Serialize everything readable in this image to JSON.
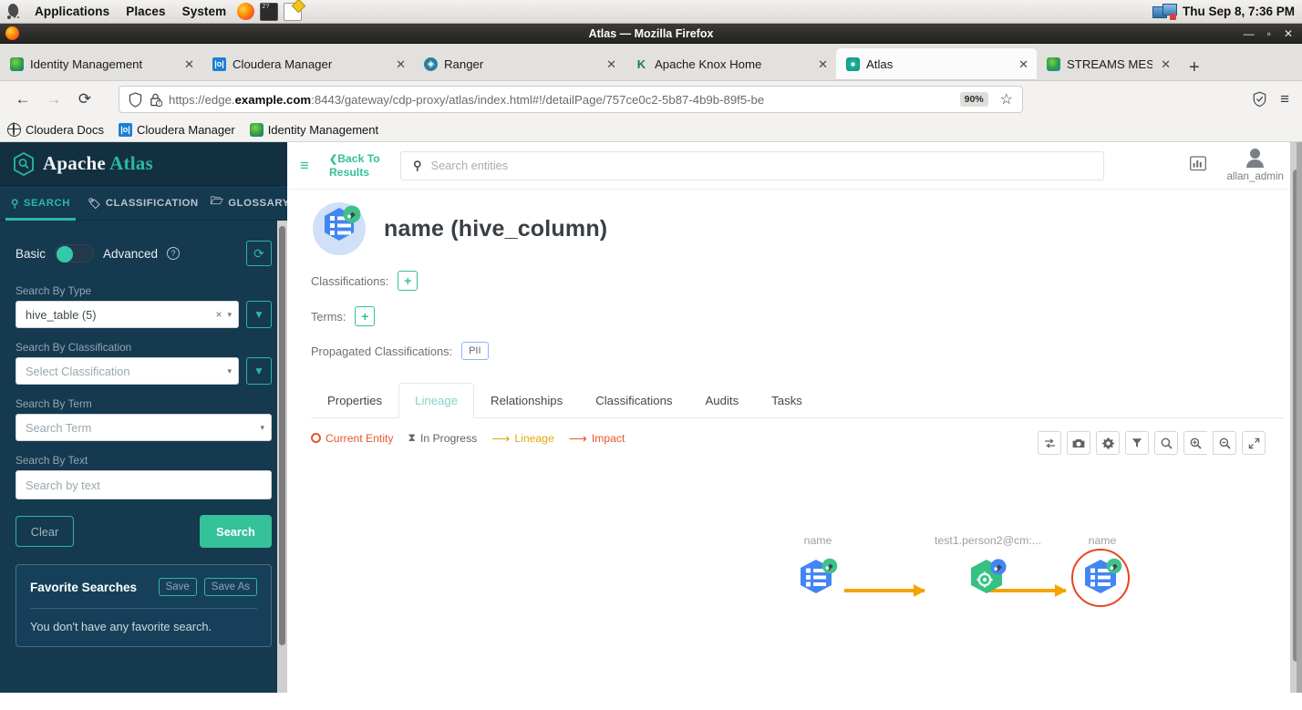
{
  "desktop": {
    "menus": [
      "Applications",
      "Places",
      "System"
    ],
    "launchers": [
      "firefox-icon",
      "terminal-icon",
      "text-editor-icon"
    ],
    "tray_icon": "displays-icon",
    "clock": "Thu Sep  8,  7:36 PM"
  },
  "window": {
    "title": "Atlas — Mozilla Firefox",
    "app_icon": "firefox-icon",
    "buttons": {
      "minimize": "—",
      "maximize": "▫",
      "close": "✕"
    }
  },
  "browser": {
    "tabs": [
      {
        "label": "Identity Management",
        "favicon": "identity-management-icon",
        "active": false
      },
      {
        "label": "Cloudera Manager",
        "favicon": "cloudera-manager-icon",
        "active": false
      },
      {
        "label": "Ranger",
        "favicon": "ranger-icon",
        "active": false
      },
      {
        "label": "Apache Knox Home",
        "favicon": "knox-icon",
        "active": false
      },
      {
        "label": "Atlas",
        "favicon": "atlas-icon",
        "active": true
      },
      {
        "label": "STREAMS MESSAGING M",
        "favicon": "smm-icon",
        "active": false
      }
    ],
    "new_tab_label": "+",
    "nav": {
      "back": "←",
      "forward": "→",
      "reload": "⟳"
    },
    "url": {
      "scheme": "https://edge.",
      "domain": "example.com",
      "path": ":8443/gateway/cdp-proxy/atlas/index.html#!/detailPage/757ce0c2-5b87-4b9b-89f5-be",
      "zoom_level": "90%",
      "shield_icon": "shield-icon",
      "lock_icon": "lock-warning-icon",
      "bookmark_icon": "star-icon"
    },
    "toolbar_right": [
      "tracking-protection-icon",
      "hamburger-menu-icon"
    ],
    "bookmarks": [
      {
        "label": "Cloudera Docs",
        "icon": "globe-icon"
      },
      {
        "label": "Cloudera Manager",
        "icon": "cloudera-manager-icon"
      },
      {
        "label": "Identity Management",
        "icon": "identity-management-icon"
      }
    ]
  },
  "atlas": {
    "brand": {
      "word1": "Apache",
      "word2": "Atlas",
      "icon": "atlas-hex-icon"
    },
    "side_tabs": [
      {
        "label": "SEARCH",
        "icon": "search-icon",
        "active": true
      },
      {
        "label": "CLASSIFICATION",
        "icon": "tag-icon",
        "active": false
      },
      {
        "label": "GLOSSARY",
        "icon": "folder-icon",
        "active": false
      }
    ],
    "search_panel": {
      "mode_basic": "Basic",
      "mode_advanced": "Advanced",
      "help_icon": "question-mark-icon",
      "refresh_icon": "refresh-icon",
      "fields": [
        {
          "label": "Search By Type",
          "value": "hive_table (5)",
          "is_placeholder": false,
          "clear_icon": "×",
          "caret": "▾",
          "filter_icon": "funnel-icon"
        },
        {
          "label": "Search By Classification",
          "value": "Select Classification",
          "is_placeholder": true,
          "caret": "▾",
          "filter_icon": "funnel-icon"
        },
        {
          "label": "Search By Term",
          "value": "Search Term",
          "is_placeholder": true,
          "caret": "▾"
        },
        {
          "label": "Search By Text",
          "value": "Search by text",
          "is_placeholder": true
        }
      ],
      "clear_label": "Clear",
      "search_label": "Search",
      "favorites": {
        "title": "Favorite Searches",
        "save_label": "Save",
        "save_as_label": "Save As",
        "empty_text": "You don't have any favorite search."
      }
    },
    "topbar": {
      "menu_icon": "hamburger-menu-icon",
      "back_label": "Back To Results",
      "back_chevron": "❮",
      "search_placeholder": "Search entities",
      "search_icon": "search-icon",
      "stats_icon": "statistics-icon",
      "user_icon": "user-avatar-icon",
      "user_name": "allan_admin"
    },
    "entity": {
      "icon": "hive-column-icon",
      "title": "name (hive_column)",
      "classifications_label": "Classifications:",
      "classifications_add": "+",
      "terms_label": "Terms:",
      "terms_add": "+",
      "propagated_label": "Propagated Classifications:",
      "propagated_values": [
        "PII"
      ]
    },
    "tabs": [
      {
        "label": "Properties",
        "active": false
      },
      {
        "label": "Lineage",
        "active": true
      },
      {
        "label": "Relationships",
        "active": false
      },
      {
        "label": "Classifications",
        "active": false
      },
      {
        "label": "Audits",
        "active": false
      },
      {
        "label": "Tasks",
        "active": false
      }
    ],
    "lineage": {
      "legend": [
        {
          "label": "Current Entity",
          "marker": "ring-marker",
          "color": "#e8562a"
        },
        {
          "label": "In Progress",
          "marker": "hourglass-marker",
          "color": "#5f6368"
        },
        {
          "label": "Lineage",
          "marker": "arrow-marker",
          "color": "#e0a80e"
        },
        {
          "label": "Impact",
          "marker": "arrow-marker",
          "color": "#e8562a"
        }
      ],
      "tools": [
        {
          "name": "reset-layout-icon",
          "glyph": "⇄"
        },
        {
          "name": "camera-icon",
          "glyph": "▣"
        },
        {
          "name": "settings-gear-icon",
          "glyph": "✾"
        },
        {
          "name": "filter-funnel-icon",
          "glyph": "▼"
        },
        {
          "name": "search-icon",
          "glyph": "⚲"
        },
        {
          "name": "zoom-in-icon",
          "glyph": "⊕"
        },
        {
          "name": "zoom-out-icon",
          "glyph": "⊖"
        },
        {
          "name": "fullscreen-icon",
          "glyph": "⤢"
        }
      ],
      "nodes": [
        {
          "label": "name",
          "type": "column",
          "current": false
        },
        {
          "label": "test1.person2@cm:...",
          "type": "process",
          "current": false
        },
        {
          "label": "name",
          "type": "column",
          "current": true
        }
      ],
      "edges": [
        {
          "from": 0,
          "to": 1,
          "color": "#f5a302"
        },
        {
          "from": 1,
          "to": 2,
          "color": "#f5a302"
        }
      ]
    }
  },
  "colors": {
    "atlas_teal": "#35c19a",
    "sidebar_navy": "#15394f",
    "orange_arrow": "#f5a302",
    "current_entity_red": "#e8441f",
    "node_blue": "#4285f4",
    "node_green": "#34a853"
  }
}
